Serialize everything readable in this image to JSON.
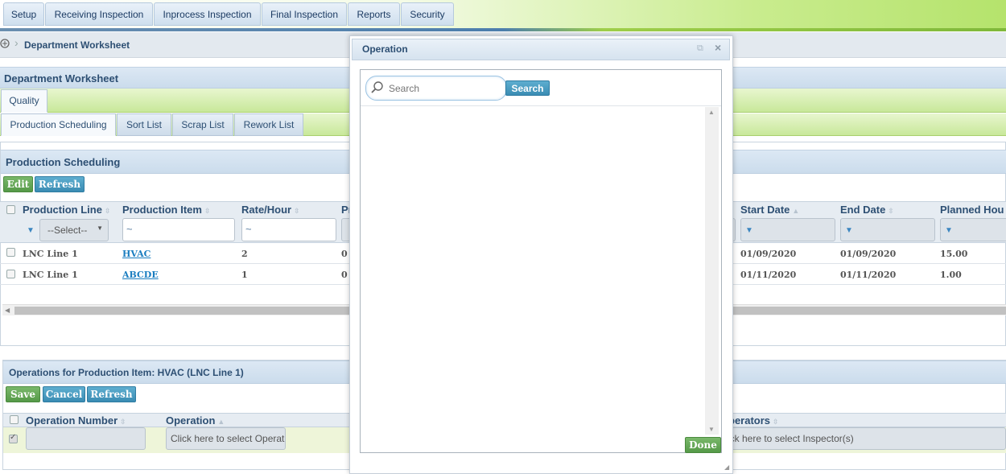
{
  "top_menu": [
    "Setup",
    "Receiving Inspection",
    "Inprocess Inspection",
    "Final Inspection",
    "Reports",
    "Security"
  ],
  "breadcrumb": "Department Worksheet",
  "page_title": "Department Worksheet",
  "category_tab": "Quality",
  "tabs": [
    "Production Scheduling",
    "Sort List",
    "Scrap List",
    "Rework List"
  ],
  "production_scheduling": {
    "title": "Production Scheduling",
    "edit": "Edit",
    "refresh": "Refresh",
    "columns": [
      "Production Line",
      "Production Item",
      "Rate/Hour",
      "Pr",
      "Start Date",
      "End Date",
      "Planned Hou"
    ],
    "line_filter": "--Select--",
    "tilde": "~",
    "rows": [
      {
        "line": "LNC Line 1",
        "item": "HVAC",
        "rate": "2",
        "p": "0",
        "start": "01/09/2020",
        "end": "01/09/2020",
        "hours": "15.00"
      },
      {
        "line": "LNC Line 1",
        "item": "ABCDE",
        "rate": "1",
        "p": "0",
        "start": "01/11/2020",
        "end": "01/11/2020",
        "hours": "1.00"
      }
    ]
  },
  "operations": {
    "title": "Operations for Production Item: HVAC (LNC Line 1)",
    "save": "Save",
    "cancel": "Cancel",
    "refresh": "Refresh",
    "col_op_number": "Operation Number",
    "col_operation": "Operation",
    "col_operators": "perators",
    "op_placeholder": "Click here to select Operat",
    "inspector_placeholder": "ick here to select Inspector(s)"
  },
  "dialog": {
    "title": "Operation",
    "search_placeholder": "Search",
    "search_button": "Search",
    "done": "Done"
  }
}
